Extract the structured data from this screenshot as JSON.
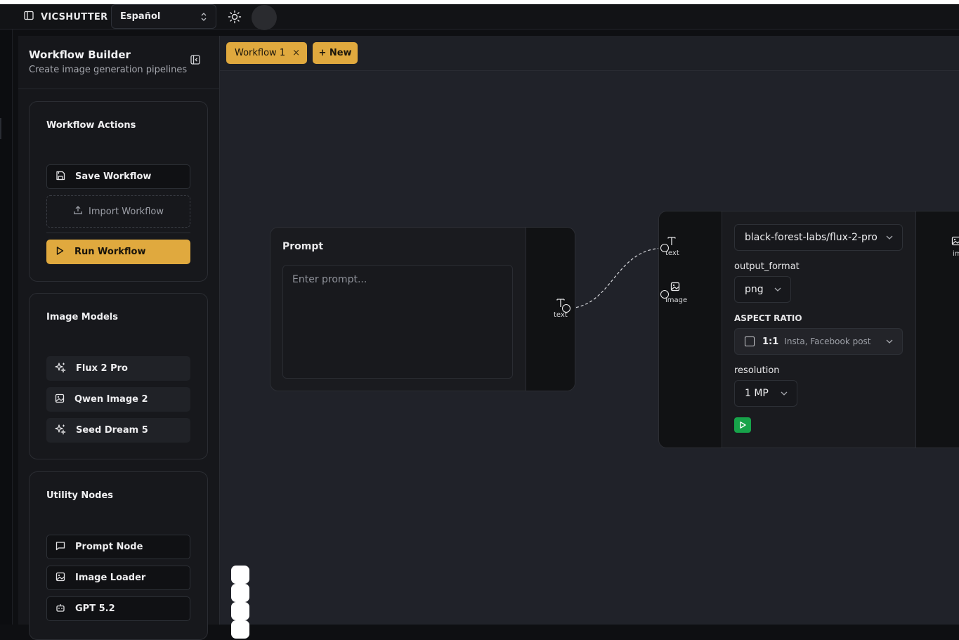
{
  "app": {
    "brand": "VICSHUTTER",
    "language": "Español"
  },
  "sidebar": {
    "title": "Workflow Builder",
    "subtitle": "Create image generation pipelines",
    "sections": {
      "actions": {
        "title": "Workflow Actions",
        "save": "Save Workflow",
        "import": "Import Workflow",
        "run": "Run Workflow"
      },
      "models": {
        "title": "Image Models",
        "items": [
          "Flux 2 Pro",
          "Qwen Image 2",
          "Seed Dream 5"
        ]
      },
      "utility": {
        "title": "Utility Nodes",
        "items": [
          "Prompt Node",
          "Image Loader",
          "GPT 5.2"
        ]
      }
    }
  },
  "tabs": {
    "active": "Workflow 1",
    "close": "×",
    "new": "+ New"
  },
  "prompt_node": {
    "title": "Prompt",
    "placeholder": "Enter prompt...",
    "output_port": "text"
  },
  "flux_node": {
    "inputs": [
      "text",
      "image"
    ],
    "model": "black-forest-labs/flux-2-pro",
    "output_format_label": "output_format",
    "output_format": "png",
    "aspect_label": "ASPECT RATIO",
    "aspect_value": "1:1",
    "aspect_hint": "Insta, Facebook post",
    "resolution_label": "resolution",
    "resolution": "1 MP",
    "output_port": "image"
  },
  "colors": {
    "accent": "#e0a93e",
    "run": "#17a34a",
    "canvas": "#202229"
  }
}
